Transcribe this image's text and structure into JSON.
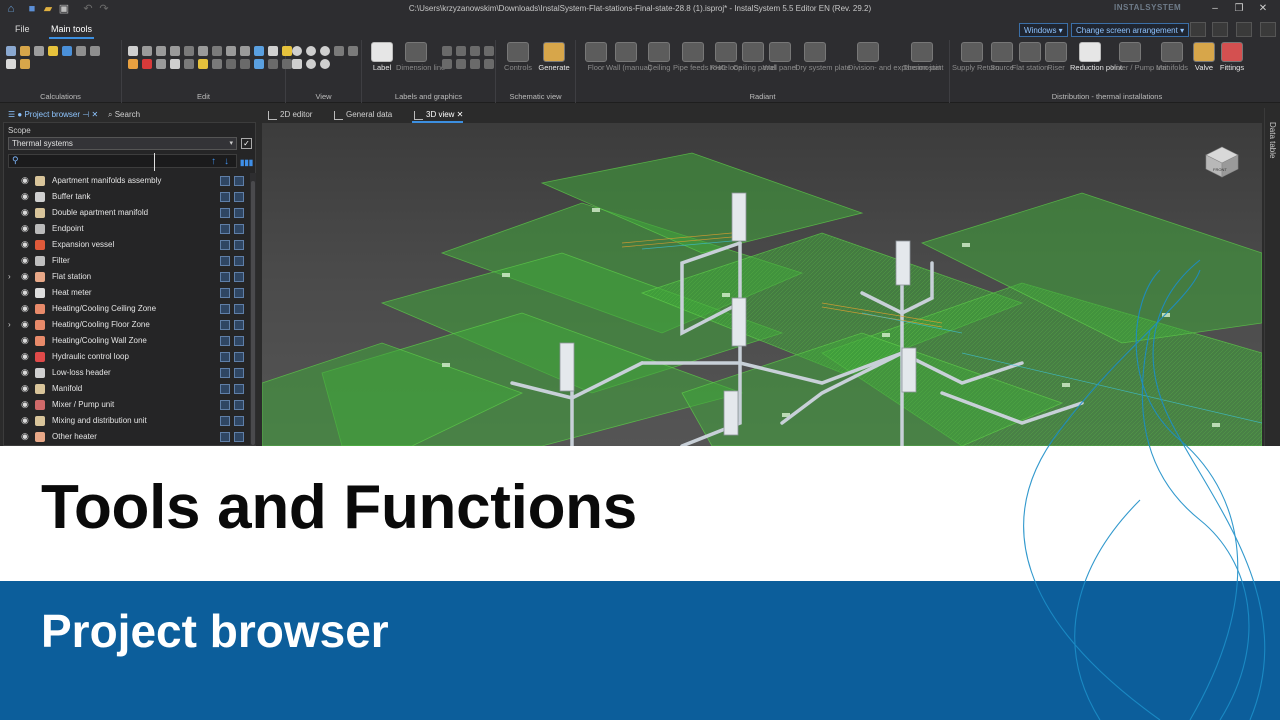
{
  "window": {
    "title": "C:\\Users\\krzyzanowskim\\Downloads\\InstalSystem-Flat-stations-Final-state-28.8 (1).isproj* - InstalSystem 5.5 Editor EN (Rev. 29.2)",
    "brand": "INSTALSYSTEM"
  },
  "menu": {
    "file": "File",
    "main_tools": "Main tools",
    "windows_dropdown": "Windows",
    "screen_dropdown": "Change screen arrangement"
  },
  "ribbon": {
    "groups": [
      "Calculations",
      "Edit",
      "View",
      "Labels and graphics",
      "Schematic view",
      "Radiant",
      "Distribution - thermal installations"
    ],
    "labels_tools": [
      "Label",
      "Dimension line"
    ],
    "schematic_tools": [
      "Controls",
      "Generate"
    ],
    "radiant_tools": [
      "Floor",
      "Wall (manual)",
      "Ceiling",
      "Pipe feeds route",
      "RHC loop",
      "Ceiling panel",
      "Wall panel",
      "Dry system plate",
      "Division- and expansion joint",
      "Thermostat"
    ],
    "distribution_tools": [
      "Supply Return",
      "Source",
      "Flat station",
      "Riser",
      "Reduction point",
      "Mixer / Pump unit",
      "Manifolds",
      "Valve",
      "Fittings"
    ]
  },
  "panel": {
    "tabs": [
      "Project browser",
      "Search"
    ],
    "scope_label": "Scope",
    "scope_value": "Thermal systems",
    "search_value": "",
    "items": [
      {
        "name": "Apartment manifolds assembly",
        "expandable": false,
        "color": "#d8c49a"
      },
      {
        "name": "Buffer tank",
        "expandable": false,
        "color": "#cfcfcf"
      },
      {
        "name": "Double apartment manifold",
        "expandable": false,
        "color": "#d8c49a"
      },
      {
        "name": "Endpoint",
        "expandable": false,
        "color": "#bbbbbb"
      },
      {
        "name": "Expansion vessel",
        "expandable": false,
        "color": "#e05a3a"
      },
      {
        "name": "Filter",
        "expandable": false,
        "color": "#bfbfbf"
      },
      {
        "name": "Flat station",
        "expandable": true,
        "color": "#e8a888"
      },
      {
        "name": "Heat meter",
        "expandable": false,
        "color": "#dddddd"
      },
      {
        "name": "Heating/Cooling Ceiling Zone",
        "expandable": false,
        "color": "#e88a6a"
      },
      {
        "name": "Heating/Cooling Floor Zone",
        "expandable": true,
        "color": "#e88a6a"
      },
      {
        "name": "Heating/Cooling Wall Zone",
        "expandable": false,
        "color": "#e88a6a"
      },
      {
        "name": "Hydraulic control loop",
        "expandable": false,
        "color": "#e04a4a"
      },
      {
        "name": "Low-loss header",
        "expandable": false,
        "color": "#cfcfcf"
      },
      {
        "name": "Manifold",
        "expandable": false,
        "color": "#d8c49a"
      },
      {
        "name": "Mixer / Pump unit",
        "expandable": false,
        "color": "#d06a6a"
      },
      {
        "name": "Mixing and distribution unit",
        "expandable": false,
        "color": "#d8c49a"
      },
      {
        "name": "Other heater",
        "expandable": false,
        "color": "#e8a888"
      }
    ]
  },
  "documents": {
    "tabs": [
      "2D editor",
      "General data",
      "3D view"
    ],
    "active_tab": "3D view",
    "side_panel": "Data table",
    "viewcube_label": "FRONT"
  },
  "banner": {
    "title": "Tools and Functions",
    "subtitle": "Project browser"
  },
  "colors": {
    "accent": "#3c8fe0",
    "banner_blue": "#0c5e9b",
    "floor_green": "#3fa53a"
  },
  "icons": [
    "home-icon",
    "save-icon",
    "open-folder-icon",
    "undo-icon",
    "redo-icon",
    "search-icon",
    "eye-icon"
  ]
}
